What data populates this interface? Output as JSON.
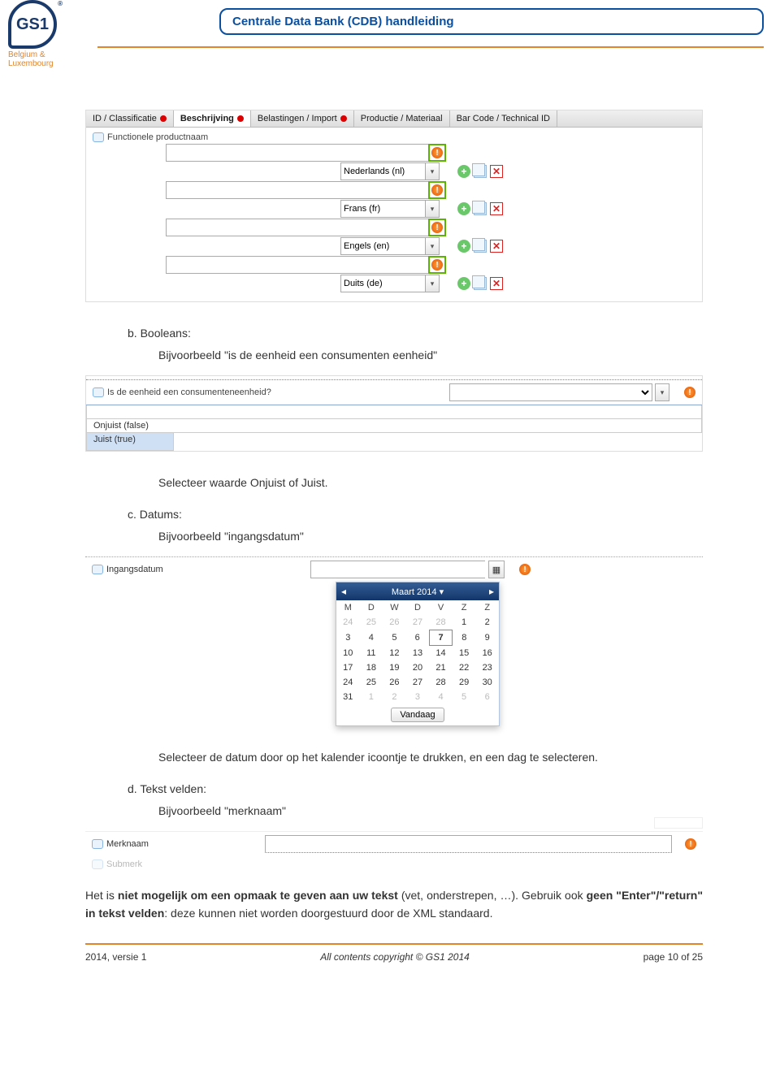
{
  "header": {
    "logo_text": "GS1",
    "logo_tm": "®",
    "logo_sub": "Belgium & Luxembourg",
    "title": "Centrale Data Bank (CDB) handleiding"
  },
  "tabs": [
    {
      "label": "ID / Classificatie",
      "active": false,
      "err": true
    },
    {
      "label": "Beschrijving",
      "active": true,
      "err": true
    },
    {
      "label": "Belastingen / Import",
      "active": false,
      "err": true
    },
    {
      "label": "Productie / Materiaal",
      "active": false,
      "err": false
    },
    {
      "label": "Bar Code / Technical ID",
      "active": false,
      "err": false
    }
  ],
  "form1": {
    "field_label": "Functionele productnaam",
    "languages": [
      "Nederlands (nl)",
      "Frans (fr)",
      "Engels (en)",
      "Duits (de)"
    ]
  },
  "section_b": {
    "hd": "b.  Booleans:",
    "bd": "Bijvoorbeeld \"is de eenheid een consumenten eenheid\""
  },
  "boolean_ss": {
    "question": "Is de eenheid een consumenteneenheid?",
    "options": [
      "",
      "Onjuist (false)",
      "Juist (true)"
    ]
  },
  "section_b2": "Selecteer waarde Onjuist of Juist.",
  "section_c": {
    "hd": "c.  Datums:",
    "bd": "Bijvoorbeeld \"ingangsdatum\""
  },
  "date_ss": {
    "label": "Ingangsdatum",
    "month": "Maart 2014",
    "dow": [
      "M",
      "D",
      "W",
      "D",
      "V",
      "Z",
      "Z"
    ],
    "grid": [
      [
        {
          "v": "24",
          "m": 1
        },
        {
          "v": "25",
          "m": 1
        },
        {
          "v": "26",
          "m": 1
        },
        {
          "v": "27",
          "m": 1
        },
        {
          "v": "28",
          "m": 1
        },
        {
          "v": "1"
        },
        {
          "v": "2"
        }
      ],
      [
        {
          "v": "3"
        },
        {
          "v": "4"
        },
        {
          "v": "5"
        },
        {
          "v": "6"
        },
        {
          "v": "7",
          "t": 1
        },
        {
          "v": "8"
        },
        {
          "v": "9"
        }
      ],
      [
        {
          "v": "10"
        },
        {
          "v": "11"
        },
        {
          "v": "12"
        },
        {
          "v": "13"
        },
        {
          "v": "14"
        },
        {
          "v": "15"
        },
        {
          "v": "16"
        }
      ],
      [
        {
          "v": "17"
        },
        {
          "v": "18"
        },
        {
          "v": "19"
        },
        {
          "v": "20"
        },
        {
          "v": "21"
        },
        {
          "v": "22"
        },
        {
          "v": "23"
        }
      ],
      [
        {
          "v": "24"
        },
        {
          "v": "25"
        },
        {
          "v": "26"
        },
        {
          "v": "27"
        },
        {
          "v": "28"
        },
        {
          "v": "29"
        },
        {
          "v": "30"
        }
      ],
      [
        {
          "v": "31"
        },
        {
          "v": "1",
          "m": 1
        },
        {
          "v": "2",
          "m": 1
        },
        {
          "v": "3",
          "m": 1
        },
        {
          "v": "4",
          "m": 1
        },
        {
          "v": "5",
          "m": 1
        },
        {
          "v": "6",
          "m": 1
        }
      ]
    ],
    "today": "Vandaag"
  },
  "section_c2": "Selecteer de datum door op het kalender icoontje te drukken, en een dag te selecteren.",
  "section_d": {
    "hd": "d.  Tekst velden:",
    "bd": "Bijvoorbeeld \"merknaam\""
  },
  "text_ss": {
    "label1": "Merknaam",
    "label2": "Submerk"
  },
  "note": {
    "line1_a": "Het is ",
    "line1_b": "niet mogelijk om een opmaak te geven aan uw tekst",
    "line1_c": " (vet, onderstrepen, …). Gebruik ook ",
    "line1_d": "geen \"Enter\"/\"return\" in tekst velden",
    "line1_e": ": deze kunnen niet worden doorgestuurd door de XML standaard."
  },
  "footer": {
    "left": "2014, versie 1",
    "center": "All contents copyright © GS1 2014",
    "right": "page 10 of 25"
  }
}
